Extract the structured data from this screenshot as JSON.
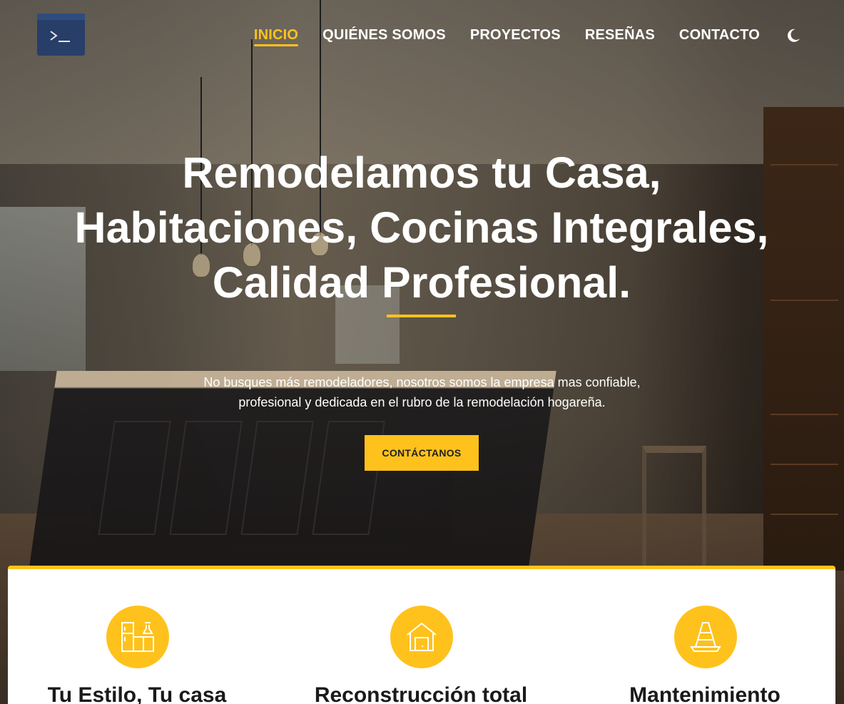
{
  "nav": {
    "items": [
      {
        "label": "INICIO",
        "active": true
      },
      {
        "label": "QUIÉNES SOMOS",
        "active": false
      },
      {
        "label": "PROYECTOS",
        "active": false
      },
      {
        "label": "RESEÑAS",
        "active": false
      },
      {
        "label": "CONTACTO",
        "active": false
      }
    ],
    "logo_icon": "terminal-prompt-icon",
    "theme_toggle_icon": "moon-icon"
  },
  "hero": {
    "title": "Remodelamos tu Casa, Habitaciones, Cocinas Integrales, Calidad Profesional.",
    "subtitle": "No busques más remodeladores, nosotros somos la empresa mas confiable, profesional y dedicada en el rubro de la remodelación hogareña.",
    "cta_label": "CONTÁCTANOS"
  },
  "services": [
    {
      "title": "Tu Estilo, Tu casa",
      "icon": "kitchen-icon"
    },
    {
      "title": "Reconstrucción total",
      "icon": "garage-icon"
    },
    {
      "title": "Mantenimiento",
      "icon": "traffic-cone-icon"
    }
  ],
  "colors": {
    "accent": "#ffc21c",
    "logo_bg": "#1e3a6e",
    "text_light": "#ffffff",
    "text_dark": "#1a1a1a"
  }
}
